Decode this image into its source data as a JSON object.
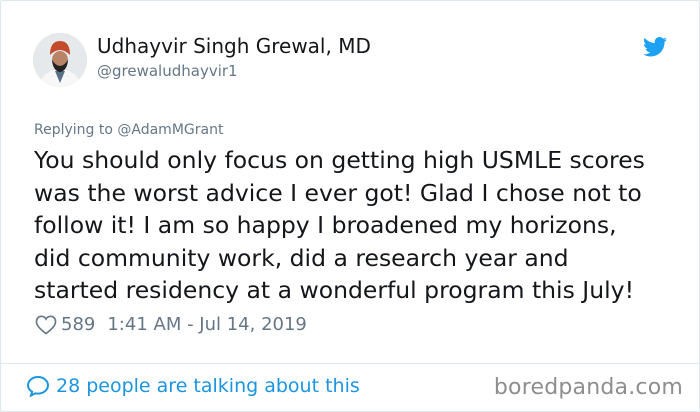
{
  "author": {
    "name": "Udhayvir Singh Grewal, MD",
    "handle": "@grewaludhayvir1"
  },
  "reply": {
    "text": "Replying to @AdamMGrant"
  },
  "tweet": {
    "lines": [
      "You should only focus on getting high USMLE scores",
      "was the worst advice I ever got! Glad I chose not to",
      "follow it! I am so happy I broadened my horizons,",
      "did community work, did a research year and",
      "started residency at a wonderful program this July!"
    ]
  },
  "meta": {
    "likes": "589",
    "timestamp": "1:41 AM - Jul 14, 2019"
  },
  "footer": {
    "talking": "28 people are talking about this"
  },
  "watermark": "boredpanda.com",
  "icons": {
    "bird": "twitter-bird-icon",
    "heart": "heart-icon",
    "bubble": "comment-bubble-icon"
  },
  "colors": {
    "accent": "#1da1f2",
    "link": "#1b95e0",
    "muted": "#657786",
    "text": "#14171a"
  }
}
